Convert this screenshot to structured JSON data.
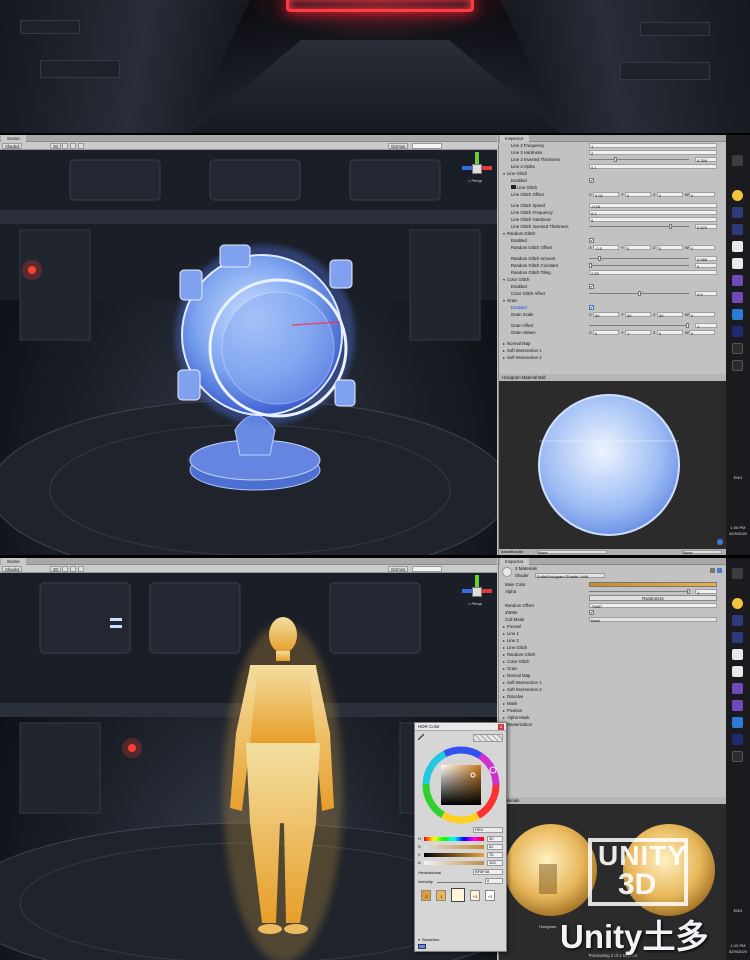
{
  "top": {},
  "u1": {
    "scene_tab": "Scene",
    "toolbar": {
      "shaded": "Shaded",
      "mode2d": "2D",
      "gizmos": "Gizmos"
    },
    "persp": "< Persp",
    "inspector_title": "Inspector",
    "rows_a": [
      {
        "label": "Line 2 Frequency",
        "value": "1"
      },
      {
        "label": "Line 2 Hardness",
        "value": "2"
      }
    ],
    "line2_inverted": {
      "label": "Line 2 Inverted Thickness",
      "value": "0.259",
      "level": 0.26
    },
    "line2_alpha": {
      "label": "Line 2 Alpha",
      "value": "0.1"
    },
    "line_glitch": "Line Glitch",
    "lg_enabled": {
      "label": "Enabled",
      "mark": "✔"
    },
    "lg_toggle": "Line Glitch",
    "lg_offset": {
      "label": "Line Glitch Offset",
      "x": "0.03",
      "y": "0",
      "z": "0",
      "w": "0"
    },
    "lg_speed": {
      "label": "Line Glitch Speed",
      "value": "-0.26"
    },
    "lg_freq": {
      "label": "Line Glitch Frequency",
      "value": "0.2"
    },
    "lg_hard": {
      "label": "Line Glitch Hardness",
      "value": "5"
    },
    "lg_inv": {
      "label": "Line Glitch Inverted Thickness",
      "value": "0.825",
      "level": 0.825
    },
    "random_glitch": "Random Glitch",
    "rg_enabled": {
      "label": "Enabled",
      "mark": "✔"
    },
    "rg_offset": {
      "label": "Random Glitch Offset",
      "x": "-0.5",
      "y": "0",
      "z": "0",
      "w": "0"
    },
    "rg_amount": {
      "label": "Random Glitch Amount",
      "value": "0.089",
      "level": 0.09
    },
    "rg_constant": {
      "label": "Random Glitch Constant",
      "value": "0",
      "level": 0
    },
    "rg_tiling": {
      "label": "Random Glitch Tiling",
      "value": "2.83"
    },
    "color_glitch": "Color Glitch",
    "cg_enabled": {
      "label": "Enabled",
      "mark": "✔"
    },
    "cg_affect": {
      "label": "Color Glitch Affect",
      "value": "0.5",
      "level": 0.5
    },
    "grain": "Grain",
    "gr_enabled": {
      "label": "Enabled",
      "mark": "✔"
    },
    "gr_scale": {
      "label": "Grain Scale",
      "x": "50",
      "y": "50",
      "z": "50",
      "w": "0"
    },
    "gr_affect": {
      "label": "Grain Affect",
      "value": "1",
      "level": 1
    },
    "gr_values": {
      "label": "Grain Values",
      "x": "0",
      "y": "1",
      "z": "0",
      "w": "0"
    },
    "normal_map": "Normal Map",
    "soft1": "Soft Intersection 1",
    "soft2": "Soft Intersection 2",
    "preview_title": "Hologram Material Ball",
    "preview_foot": "AssetBundle",
    "preview_foot2": "None",
    "preview_foot3": "None"
  },
  "u2": {
    "scene_tab": "Scene",
    "toolbar": {
      "shaded": "Shaded",
      "mode2d": "2D",
      "gizmos": "Gizmos"
    },
    "persp": "< Persp",
    "inspector_title": "Inspector",
    "materials_count": "2 Materials",
    "shader_label": "Shader",
    "shader_value": "Knife/Hologram Shader Unlit",
    "main_color": "Main Color",
    "alpha": {
      "label": "Alpha",
      "value": "1"
    },
    "randomize": "Randomize",
    "random_offset": {
      "label": "Random Offset",
      "value": "75887"
    },
    "zwrite": {
      "label": "ZWrite",
      "mark": "✔"
    },
    "cull": {
      "label": "Cull Mode",
      "value": "Back"
    },
    "sections": [
      "Fresnel",
      "Line 1",
      "Line 2",
      "Line Glitch",
      "Random Glitch",
      "Color Glitch",
      "Grain",
      "Normal Map",
      "Soft Intersection 1",
      "Soft Intersection 2",
      "Dissolve",
      "Mask",
      "Position",
      "Alpha Mask",
      "Rasterization"
    ],
    "preview_title": "Materials",
    "preview_name": "Hologram",
    "preview_foot": "Previewing 2 of 2 Objects"
  },
  "hdr": {
    "title": "HDR Color",
    "close": "x",
    "mode": "HSV",
    "channels": [
      {
        "label": "H",
        "value": "30"
      },
      {
        "label": "S",
        "value": "62"
      },
      {
        "label": "V",
        "value": "75"
      },
      {
        "label": "A",
        "value": "100"
      }
    ],
    "hex_label": "Hexadecimal",
    "hex_value": "BF8F48",
    "intensity_label": "Intensity",
    "intensity_value": "0",
    "swatches_label": "Swatches",
    "swatch_labels": [
      "-2",
      "-1",
      "",
      "+1",
      "+2"
    ]
  },
  "taskbar1": {
    "time": "1:06 PM",
    "date": "5/29/2020",
    "lang": "ENG"
  },
  "taskbar2": {
    "time": "1:19 PM",
    "date": "5/29/2020",
    "lang": "ENG"
  },
  "watermark": {
    "line1": "UNITY",
    "line2": "3D",
    "line3": "Unity土多"
  }
}
